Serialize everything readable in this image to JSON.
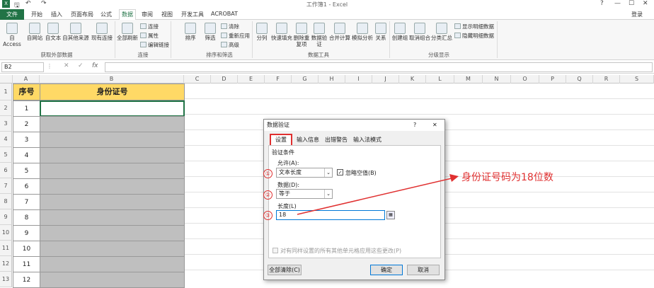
{
  "app": {
    "title": "工作簿1 - Excel",
    "login": "登录"
  },
  "window_controls": {
    "help": "?",
    "min": "—",
    "max": "☐",
    "close": "✕"
  },
  "tabs": [
    "文件",
    "开始",
    "插入",
    "页面布局",
    "公式",
    "数据",
    "审阅",
    "视图",
    "开发工具",
    "ACROBAT"
  ],
  "active_tab": "数据",
  "ribbon": {
    "buttons": [
      "自 Access",
      "自网站",
      "自文本",
      "自其他来源",
      "现有连接",
      "全部刷新",
      "排序",
      "筛选",
      "分列",
      "快速填充",
      "删除重复项",
      "数据验证",
      "合并计算",
      "模拟分析",
      "关系",
      "创建组",
      "取消组合",
      "分类汇总"
    ],
    "small": [
      "连接",
      "属性",
      "编辑链接",
      "清除",
      "重新应用",
      "高级",
      "显示明细数据",
      "隐藏明细数据"
    ],
    "groups": [
      "获取外部数据",
      "连接",
      "排序和筛选",
      "数据工具",
      "分级显示"
    ]
  },
  "formula_bar": {
    "name_box": "B2",
    "fx": "fx"
  },
  "columns": [
    "A",
    "B",
    "C",
    "D",
    "E",
    "F",
    "G",
    "H",
    "I",
    "J",
    "K",
    "L",
    "M",
    "N",
    "O",
    "P",
    "Q",
    "R",
    "S"
  ],
  "sheet": {
    "header_a": "序号",
    "header_b": "身份证号",
    "rows": [
      "1",
      "2",
      "3",
      "4",
      "5",
      "6",
      "7",
      "8",
      "9",
      "10",
      "11",
      "12"
    ]
  },
  "dialog": {
    "title": "数据验证",
    "help": "?",
    "close": "✕",
    "tabs": [
      "设置",
      "输入信息",
      "出错警告",
      "输入法模式"
    ],
    "section": "验证条件",
    "allow_label": "允许(A):",
    "allow_value": "文本长度",
    "ignore_blank": "忽略空值(B)",
    "data_label": "数据(D):",
    "data_value": "等于",
    "length_label": "长度(L)",
    "length_value": "18",
    "apply_all": "对有同样设置的所有其他单元格应用这些更改(P)",
    "clear_all": "全部清除(C)",
    "ok": "确定",
    "cancel": "取消"
  },
  "annotations": {
    "c1": "①",
    "c2": "②",
    "c3": "③",
    "note": "身份证号码为18位数"
  },
  "colors": {
    "accent": "#217346",
    "header_fill": "#ffd966",
    "gray_fill": "#bfbfbf",
    "red": "#e03030"
  }
}
